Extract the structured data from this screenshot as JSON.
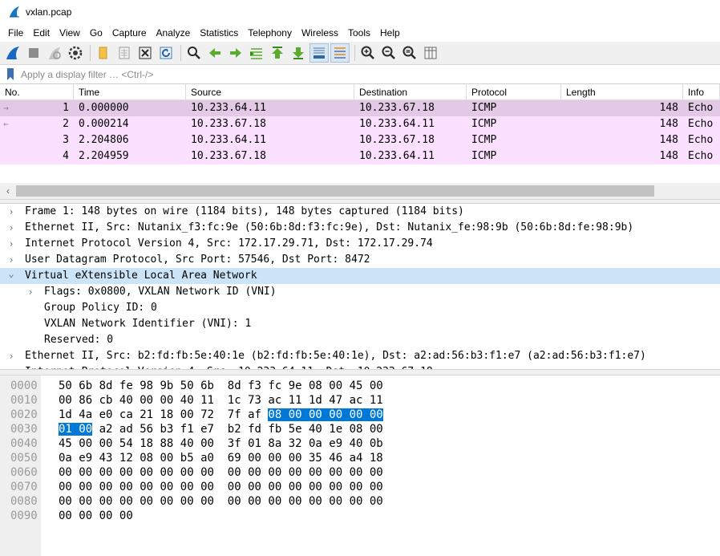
{
  "window": {
    "title": "vxlan.pcap"
  },
  "menu": [
    "File",
    "Edit",
    "View",
    "Go",
    "Capture",
    "Analyze",
    "Statistics",
    "Telephony",
    "Wireless",
    "Tools",
    "Help"
  ],
  "filter": {
    "placeholder": "Apply a display filter … <Ctrl-/>"
  },
  "packet_list": {
    "columns": [
      "No.",
      "Time",
      "Source",
      "Destination",
      "Protocol",
      "Length",
      "Info"
    ],
    "rows": [
      {
        "no": "1",
        "time": "0.000000",
        "src": "10.233.64.11",
        "dst": "10.233.67.18",
        "proto": "ICMP",
        "len": "148",
        "info": "Echo",
        "selected": true,
        "indicator": "→"
      },
      {
        "no": "2",
        "time": "0.000214",
        "src": "10.233.67.18",
        "dst": "10.233.64.11",
        "proto": "ICMP",
        "len": "148",
        "info": "Echo",
        "selected": false,
        "indicator": "←"
      },
      {
        "no": "3",
        "time": "2.204806",
        "src": "10.233.64.11",
        "dst": "10.233.67.18",
        "proto": "ICMP",
        "len": "148",
        "info": "Echo",
        "selected": false,
        "indicator": ""
      },
      {
        "no": "4",
        "time": "2.204959",
        "src": "10.233.67.18",
        "dst": "10.233.64.11",
        "proto": "ICMP",
        "len": "148",
        "info": "Echo",
        "selected": false,
        "indicator": ""
      }
    ],
    "row_color": "#fce0ff",
    "selected_row_color": "#e3c9e6"
  },
  "details": [
    {
      "level": 0,
      "expanded": false,
      "text": "Frame 1: 148 bytes on wire (1184 bits), 148 bytes captured (1184 bits)"
    },
    {
      "level": 0,
      "expanded": false,
      "text": "Ethernet II, Src: Nutanix_f3:fc:9e (50:6b:8d:f3:fc:9e), Dst: Nutanix_fe:98:9b (50:6b:8d:fe:98:9b)"
    },
    {
      "level": 0,
      "expanded": false,
      "text": "Internet Protocol Version 4, Src: 172.17.29.71, Dst: 172.17.29.74"
    },
    {
      "level": 0,
      "expanded": false,
      "text": "User Datagram Protocol, Src Port: 57546, Dst Port: 8472"
    },
    {
      "level": 0,
      "expanded": true,
      "selected": true,
      "text": "Virtual eXtensible Local Area Network"
    },
    {
      "level": 1,
      "expanded": false,
      "text": "Flags: 0x0800, VXLAN Network ID (VNI)"
    },
    {
      "level": 1,
      "leaf": true,
      "text": "Group Policy ID: 0"
    },
    {
      "level": 1,
      "leaf": true,
      "text": "VXLAN Network Identifier (VNI): 1"
    },
    {
      "level": 1,
      "leaf": true,
      "text": "Reserved: 0"
    },
    {
      "level": 0,
      "expanded": false,
      "text": "Ethernet II, Src: b2:fd:fb:5e:40:1e (b2:fd:fb:5e:40:1e), Dst: a2:ad:56:b3:f1:e7 (a2:ad:56:b3:f1:e7)"
    },
    {
      "level": 0,
      "expanded": false,
      "text": "Internet Protocol Version 4, Src: 10.233.64.11, Dst: 10.233.67.18"
    }
  ],
  "bytes": [
    {
      "offset": "0000",
      "hex": [
        "50",
        "6b",
        "8d",
        "fe",
        "98",
        "9b",
        "50",
        "6b",
        "8d",
        "f3",
        "fc",
        "9e",
        "08",
        "00",
        "45",
        "00"
      ]
    },
    {
      "offset": "0010",
      "hex": [
        "00",
        "86",
        "cb",
        "40",
        "00",
        "00",
        "40",
        "11",
        "1c",
        "73",
        "ac",
        "11",
        "1d",
        "47",
        "ac",
        "11"
      ]
    },
    {
      "offset": "0020",
      "hex": [
        "1d",
        "4a",
        "e0",
        "ca",
        "21",
        "18",
        "00",
        "72",
        "7f",
        "af",
        "08",
        "00",
        "00",
        "00",
        "00",
        "00"
      ]
    },
    {
      "offset": "0030",
      "hex": [
        "01",
        "00",
        "a2",
        "ad",
        "56",
        "b3",
        "f1",
        "e7",
        "b2",
        "fd",
        "fb",
        "5e",
        "40",
        "1e",
        "08",
        "00"
      ]
    },
    {
      "offset": "0040",
      "hex": [
        "45",
        "00",
        "00",
        "54",
        "18",
        "88",
        "40",
        "00",
        "3f",
        "01",
        "8a",
        "32",
        "0a",
        "e9",
        "40",
        "0b"
      ]
    },
    {
      "offset": "0050",
      "hex": [
        "0a",
        "e9",
        "43",
        "12",
        "08",
        "00",
        "b5",
        "a0",
        "69",
        "00",
        "00",
        "00",
        "35",
        "46",
        "a4",
        "18"
      ]
    },
    {
      "offset": "0060",
      "hex": [
        "00",
        "00",
        "00",
        "00",
        "00",
        "00",
        "00",
        "00",
        "00",
        "00",
        "00",
        "00",
        "00",
        "00",
        "00",
        "00"
      ]
    },
    {
      "offset": "0070",
      "hex": [
        "00",
        "00",
        "00",
        "00",
        "00",
        "00",
        "00",
        "00",
        "00",
        "00",
        "00",
        "00",
        "00",
        "00",
        "00",
        "00"
      ]
    },
    {
      "offset": "0080",
      "hex": [
        "00",
        "00",
        "00",
        "00",
        "00",
        "00",
        "00",
        "00",
        "00",
        "00",
        "00",
        "00",
        "00",
        "00",
        "00",
        "00"
      ]
    },
    {
      "offset": "0090",
      "hex": [
        "00",
        "00",
        "00",
        "00"
      ]
    }
  ],
  "highlight": {
    "start": 42,
    "end": 49,
    "color": "#0078d7"
  }
}
